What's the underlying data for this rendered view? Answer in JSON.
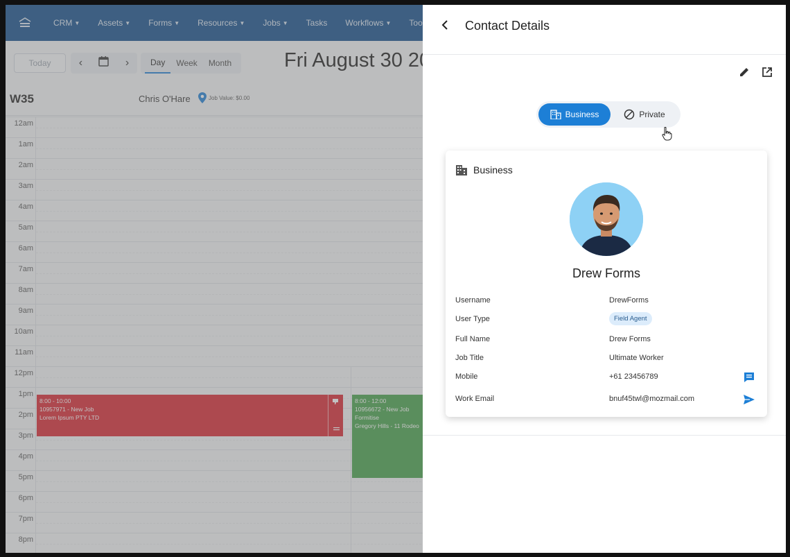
{
  "nav": {
    "items": [
      {
        "label": "CRM",
        "caret": true
      },
      {
        "label": "Assets",
        "caret": true
      },
      {
        "label": "Forms",
        "caret": true
      },
      {
        "label": "Resources",
        "caret": true
      },
      {
        "label": "Jobs",
        "caret": true
      },
      {
        "label": "Tasks",
        "caret": false
      },
      {
        "label": "Workflows",
        "caret": true
      },
      {
        "label": "Tool",
        "caret": false
      }
    ]
  },
  "toolbar": {
    "today_label": "Today",
    "views": [
      "Day",
      "Week",
      "Month"
    ],
    "active_view": "Day",
    "date_title": "Fri August 30 20"
  },
  "calendar": {
    "week_label": "W35",
    "staff_name": "Chris O'Hare",
    "job_value": "Job Value: $0.00",
    "hours": [
      "12am",
      "1am",
      "2am",
      "3am",
      "4am",
      "5am",
      "6am",
      "7am",
      "8am",
      "9am",
      "10am",
      "11am",
      "12pm",
      "1pm",
      "2pm",
      "3pm",
      "4pm",
      "5pm",
      "6pm",
      "7pm",
      "8pm"
    ],
    "events": [
      {
        "time": "8:00 - 10:00",
        "title": "10957971 - New Job",
        "subtitle": "Lorem Ipsum PTY LTD",
        "color": "#d9232f"
      },
      {
        "time": "8:00 - 12:00",
        "title": "10956672 - New Job",
        "subtitle": "Formitise",
        "extra": "Gregory Hills - 11 Rodeo",
        "color": "#43a047"
      }
    ]
  },
  "panel": {
    "title": "Contact Details",
    "toggle": {
      "business": "Business",
      "private": "Private",
      "selected": "Business"
    },
    "card_title": "Business",
    "contact_name": "Drew Forms",
    "fields": {
      "username": {
        "label": "Username",
        "value": "DrewForms"
      },
      "user_type": {
        "label": "User Type",
        "value": "Field Agent"
      },
      "full_name": {
        "label": "Full Name",
        "value": "Drew Forms"
      },
      "job_title": {
        "label": "Job Title",
        "value": "Ultimate Worker"
      },
      "mobile": {
        "label": "Mobile",
        "value": "+61 23456789"
      },
      "work_email": {
        "label": "Work Email",
        "value": "bnuf45twl@mozmail.com"
      }
    }
  },
  "colors": {
    "nav_bg": "#0f4c8a",
    "accent": "#1d7fd6",
    "event_red": "#d9232f",
    "event_green": "#43a047"
  }
}
